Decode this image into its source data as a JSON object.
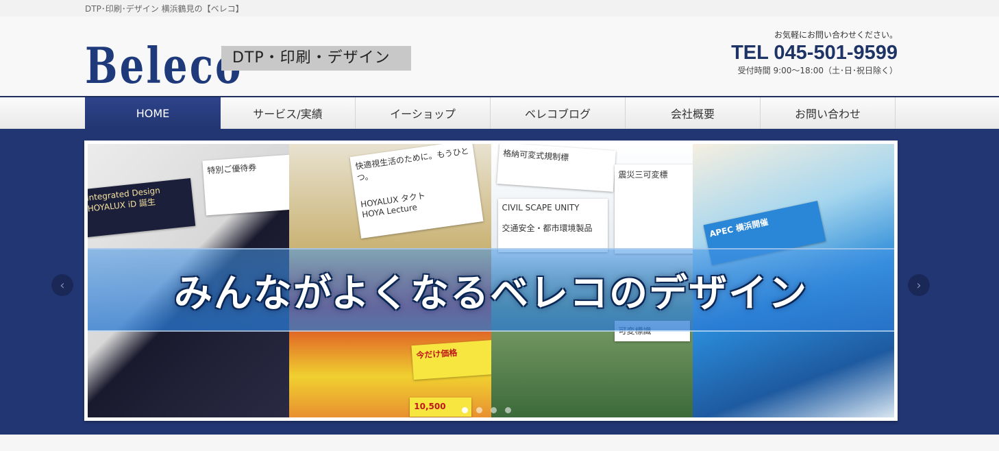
{
  "topbar": {
    "tagline": "DTP･印刷･デザイン 横浜鶴見の【ベレコ】"
  },
  "header": {
    "logo": "Beleco",
    "logo_sub": "DTP・印刷・デザイン",
    "contact_note": "お気軽にお問い合わせください。",
    "tel": "TEL 045-501-9599",
    "hours": "受付時間 9:00～18:00（土･日･祝日除く）"
  },
  "nav": {
    "items": [
      {
        "label": "HOME"
      },
      {
        "label": "サービス/実績"
      },
      {
        "label": "イーショップ"
      },
      {
        "label": "ベレコブログ"
      },
      {
        "label": "会社概要"
      },
      {
        "label": "お問い合わせ"
      }
    ],
    "active_index": 0
  },
  "slider": {
    "banner_text": "みんながよくなるベレコのデザイン",
    "cards": {
      "c1": "Integrated Design",
      "c2": "HOYALUX iD 誕生",
      "c3": "特別ご優待券",
      "c4": "快適視生活のために。もうひとつ。",
      "c5": "HOYALUX タクト",
      "c6": "HOYA Lecture",
      "c7": "格納可変式規制標",
      "c8": "震災三可変標",
      "c9": "交通安全・都市環境製品",
      "c10": "CIVIL SCAPE UNITY",
      "c11": "APEC 横浜開催",
      "c12": "今だけ価格",
      "c13": "10,500",
      "c14": "可変標識"
    },
    "prev_icon": "chevron-left-icon",
    "next_icon": "chevron-right-icon",
    "slide_count": 4,
    "current_slide": 1
  },
  "colors": {
    "brand": "#1f3466",
    "nav_active": "#2a3e80",
    "stage": "#223674"
  }
}
